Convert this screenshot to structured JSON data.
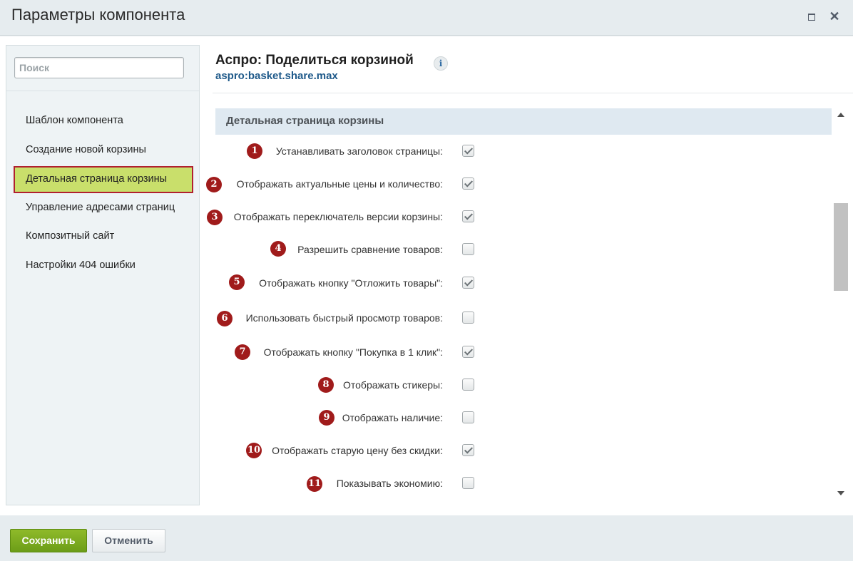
{
  "window": {
    "title": "Параметры компонента",
    "maximize_icon": "maximize-icon",
    "close_glyph": "✕"
  },
  "search": {
    "placeholder": "Поиск",
    "value": ""
  },
  "sidebar": {
    "items": [
      {
        "label": "Шаблон компонента",
        "active": false
      },
      {
        "label": "Создание новой корзины",
        "active": false
      },
      {
        "label": "Детальная страница корзины",
        "active": true
      },
      {
        "label": "Управление адресами страниц",
        "active": false
      },
      {
        "label": "Композитный сайт",
        "active": false
      },
      {
        "label": "Настройки 404 ошибки",
        "active": false
      }
    ]
  },
  "component": {
    "title": "Аспро: Поделиться корзиной",
    "code": "aspro:basket.share.max",
    "info_glyph": "i"
  },
  "section": {
    "title": "Детальная страница корзины",
    "params": [
      {
        "num": "1",
        "label": "Устанавливать заголовок страницы:",
        "checked": true
      },
      {
        "num": "2",
        "label": "Отображать актуальные цены и количество:",
        "checked": true
      },
      {
        "num": "3",
        "label": "Отображать переключатель версии корзины:",
        "checked": true
      },
      {
        "num": "4",
        "label": "Разрешить сравнение товаров:",
        "checked": false
      },
      {
        "num": "5",
        "label": "Отображать кнопку \"Отложить товары\":",
        "checked": true
      },
      {
        "num": "6",
        "label": "Использовать быстрый просмотр товаров:",
        "checked": false
      },
      {
        "num": "7",
        "label": "Отображать кнопку \"Покупка в 1 клик\":",
        "checked": true
      },
      {
        "num": "8",
        "label": "Отображать стикеры:",
        "checked": false
      },
      {
        "num": "9",
        "label": "Отображать наличие:",
        "checked": false
      },
      {
        "num": "10",
        "label": "Отображать старую цену без скидки:",
        "checked": true
      },
      {
        "num": "11",
        "label": "Показывать экономию:",
        "checked": false
      }
    ]
  },
  "footer": {
    "save_label": "Сохранить",
    "cancel_label": "Отменить"
  },
  "colors": {
    "save_button": "#7aa81f",
    "active_item_bg": "#c9df6b",
    "active_item_border": "#b1202f",
    "badge": "#a01b1b",
    "section_header_bg": "#dfe9f1",
    "component_code": "#1f5a8a"
  }
}
